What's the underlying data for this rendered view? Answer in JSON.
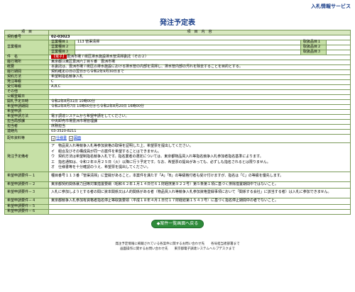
{
  "service_title": "入札情報サービス",
  "page_title": "発注予定表",
  "header": {
    "item": "項　目",
    "content": "項　目　内　容"
  },
  "contract_no": {
    "label": "契約番号",
    "value": "02-03023"
  },
  "business": {
    "label": "営業種目",
    "rows": [
      {
        "name": "営業種目１",
        "value": "113 管渠清掃",
        "pcode": "取扱品目１",
        "pvalue": ""
      },
      {
        "name": "営業種目２",
        "value": "",
        "pcode": "取扱品目２",
        "pvalue": ""
      },
      {
        "name": "営業種目３",
        "value": "",
        "pcode": "取扱品目３",
        "pvalue": ""
      }
    ]
  },
  "subject": {
    "label": "件　名",
    "tag": "【電子】",
    "text": "豊洲市場７街区排水施設排水管清掃委託（その２）"
  },
  "place": {
    "label": "履行場所",
    "value": "東京都江東区豊洲六丁目６番　豊洲市場"
  },
  "summary": {
    "label": "概要",
    "value": "本委託は、豊洲市場７街区の排水施設における排水管の内部を清掃し、排水管内部の汚れを除去することを目的とする。"
  },
  "period": {
    "label": "履行期間",
    "value": "契約確定の日の翌日から令和2年9月30日まで"
  },
  "method": {
    "label": "契約方法",
    "value": "希望制指名競争入札"
  },
  "grade": {
    "label": "発注等級",
    "value": "C"
  },
  "accept_grade": {
    "label": "受付等級",
    "value": "A,B,C"
  },
  "other": {
    "label": "その他",
    "value": ""
  },
  "notice_date": {
    "label": "公報登載日",
    "value": ""
  },
  "open_date": {
    "label": "開札予定日時",
    "value": "令和2年8月31日 10時00分"
  },
  "apply_period": {
    "label": "希望申請期間",
    "value": "令和2年8月7日 10時00分から令和2年8月20日 16時00分"
  },
  "apply_note": {
    "label": "希望申請",
    "value": ""
  },
  "apply_method": {
    "label": "希望申請方法",
    "value": "電子調達システムから希望申請をしてください。"
  },
  "dept": {
    "label": "担当局部課",
    "value": "中央卸売市場豊洲市場管理課"
  },
  "person": {
    "label": "担当者",
    "value": "庶務担当"
  },
  "tel": {
    "label": "連絡先",
    "value": "03-3520-8211"
  },
  "docs": {
    "label": "配布資料等",
    "files": [
      "仕様書",
      "図面"
    ]
  },
  "nomination": {
    "label": "発注予定備考",
    "lines": [
      "ア　物品買入れ等競争入札等参加資格の取得を証明した上、希望票を提出してください。",
      "イ　組合及びその構成員が同一の案件を希望することはできません。",
      "ウ　契約方法は希望制指名競争入札です。指名業者の選定については、東京都物品買入れ等指名競争入札参加者指名基準によります。",
      "エ　指名通知は、令和２年８月２５日（火）以降に行う予定です。なお、希望票の提出があっても、必ずしも指名されるとは限りません。",
      "オ　仕様書等を十分確認のうえ、希望票を提出してください。"
    ]
  },
  "req1": {
    "label": "希望申請要件－１",
    "value": "種目番号１１３番「管渠清掃」に登録があること。本案件を満たす「A」「B」の等級格付者も受け付けますが、指名は「C」の等級を優先します。"
  },
  "req2": {
    "label": "希望申請要件－２",
    "value": "東京都契約関係暴力団等対策措置要綱（昭和６２年１月１４日付６１財経庶第９２２号）第５条第１項に基づく排除措置期間中ではないこと。"
  },
  "req3": {
    "label": "希望申請要件－３",
    "value": "入札に参加しようとする者の間に資本関係又は人的関係がある者（物品買入れ等競争入札参加資格登録事項において「関係する会社」に該当する者）は入札に参加できません。"
  },
  "req4": {
    "label": "希望申請要件－４",
    "value": "東京都競争入札参加有資格者指名停止等取扱要領（平成１８年４月１日付１７財経総第１５４３号）に基づく指名停止期間中の者でないこと。"
  },
  "req5": {
    "label": "希望申請要件－５",
    "value": ""
  },
  "req6": {
    "label": "希望申請要件－６",
    "value": ""
  },
  "back_button": "◆案件一覧画面へ戻る",
  "footer": {
    "line1": "発注予定情報に掲載されている各案件に関するお問い合わせ先　　各局担当者部署まで",
    "line2": "画面操作に関するお問い合わせ先　　東京都電子調達システムヘルプデスクまで"
  },
  "colors": {
    "title": "#1a3f8a",
    "label_bg": "#c6e0a6",
    "header_bg": "#d8e8c0",
    "button_bg": "#2e8b3a",
    "tag_bg": "#c00000"
  },
  "icons": [
    "file-icon",
    "file-icon"
  ]
}
